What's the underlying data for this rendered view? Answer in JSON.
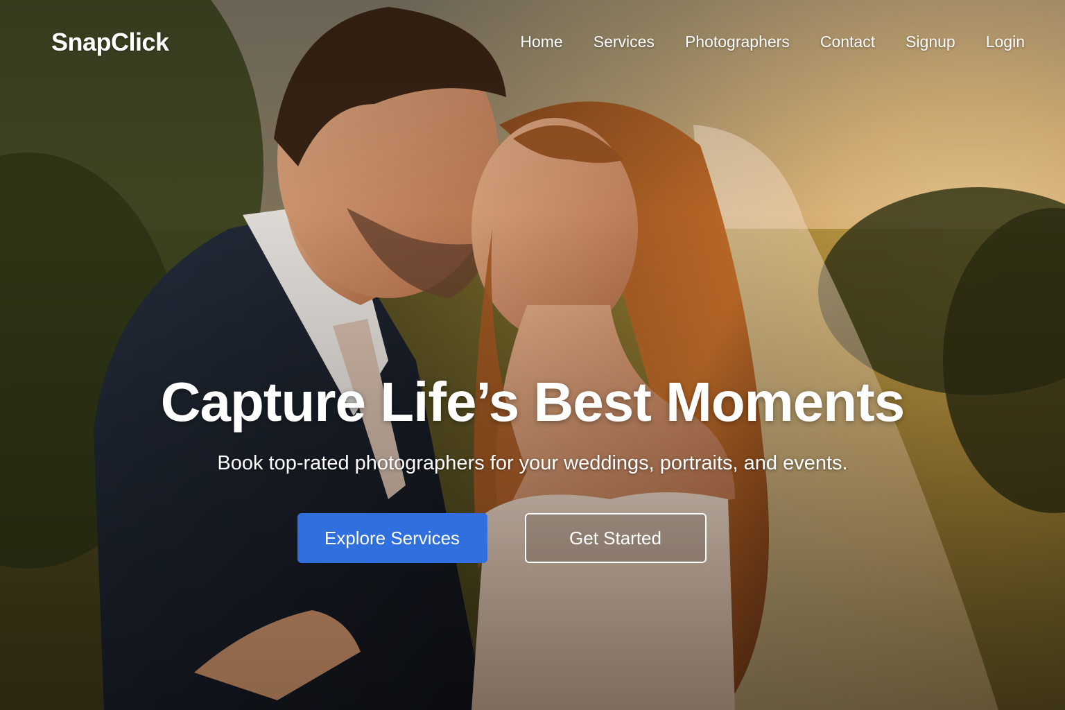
{
  "brand": {
    "name": "SnapClick"
  },
  "nav": {
    "links": [
      "Home",
      "Services",
      "Photographers",
      "Contact",
      "Signup",
      "Login"
    ]
  },
  "hero": {
    "title": "Capture Life’s Best Moments",
    "subtitle": "Book top-rated photographers for your weddings, portraits, and events.",
    "primary_button": "Explore Services",
    "secondary_button": "Get Started",
    "image_description_icon": "wedding-couple-photo"
  },
  "colors": {
    "accent": "#2f6fde",
    "text": "#ffffff"
  }
}
